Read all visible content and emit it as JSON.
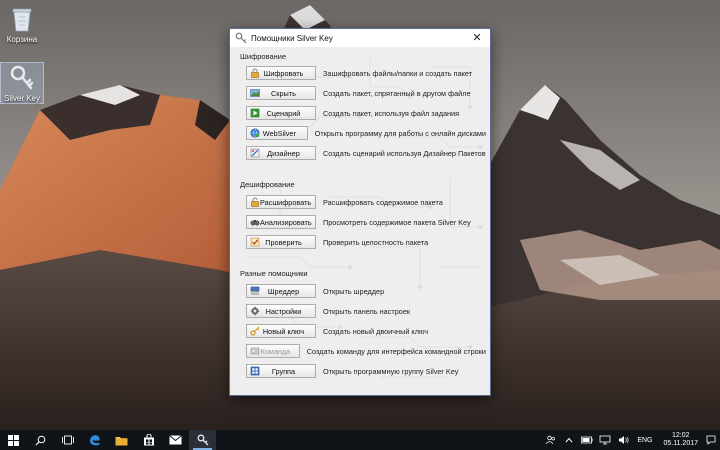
{
  "desktop": {
    "icons": [
      {
        "label": "Корзина",
        "icon": "recycle-bin-icon"
      },
      {
        "label": "Silver Key",
        "icon": "silver-key-icon"
      }
    ]
  },
  "dialog": {
    "title": "Помощники Silver Key",
    "close_glyph": "✕",
    "sections": [
      {
        "title": "Шифрование",
        "rows": [
          {
            "button": "Шифровать",
            "icon": "lock-icon",
            "description": "Зашифровать файлы/папки и создать пакет",
            "enabled": true
          },
          {
            "button": "Скрыть",
            "icon": "image-icon",
            "description": "Создать пакет, спрятанный в другом файле",
            "enabled": true
          },
          {
            "button": "Сценарий",
            "icon": "script-icon",
            "description": "Создать пакет, используя файл задания",
            "enabled": true
          },
          {
            "button": "WebSilver",
            "icon": "globe-icon",
            "description": "Открыть программу для работы с онлайн дисками",
            "enabled": true
          },
          {
            "button": "Дизайнер",
            "icon": "designer-icon",
            "description": "Создать сценарий используя Дизайнер Пакетов",
            "enabled": true
          }
        ]
      },
      {
        "title": "Дешифрование",
        "rows": [
          {
            "button": "Расшифровать",
            "icon": "unlock-icon",
            "description": "Расшифровать содержимое пакета",
            "enabled": true
          },
          {
            "button": "Анализировать",
            "icon": "binoculars-icon",
            "description": "Просмотреть содержимое пакета Silver Key",
            "enabled": true
          },
          {
            "button": "Проверить",
            "icon": "checkmark-icon",
            "description": "Проверить целостность пакета",
            "enabled": true
          }
        ]
      },
      {
        "title": "Разные помощники",
        "rows": [
          {
            "button": "Шреддер",
            "icon": "shredder-icon",
            "description": "Открыть шреддер",
            "enabled": true
          },
          {
            "button": "Настройки",
            "icon": "settings-icon",
            "description": "Открыть панель настроек",
            "enabled": true
          },
          {
            "button": "Новый ключ",
            "icon": "key-icon",
            "description": "Создать новый двоичный ключ",
            "enabled": true
          },
          {
            "button": "Команда",
            "icon": "command-icon",
            "description": "Создать команду для интерфейса командной строки",
            "enabled": false
          },
          {
            "button": "Группа",
            "icon": "group-icon",
            "description": "Открыть программную группу Silver Key",
            "enabled": true
          }
        ]
      }
    ]
  },
  "taskbar": {
    "buttons": [
      {
        "name": "start-button",
        "icon": "windows-logo-icon"
      },
      {
        "name": "search-button",
        "icon": "search-icon"
      },
      {
        "name": "task-view-button",
        "icon": "task-view-icon"
      },
      {
        "name": "edge-button",
        "icon": "edge-icon"
      },
      {
        "name": "file-explorer-button",
        "icon": "folder-icon"
      },
      {
        "name": "store-button",
        "icon": "store-icon"
      },
      {
        "name": "mail-button",
        "icon": "mail-icon"
      },
      {
        "name": "silver-key-taskbar-button",
        "icon": "silver-key-icon",
        "active": true
      }
    ],
    "tray": {
      "language": "ENG",
      "time": "12:02",
      "date": "05.11.2017"
    }
  },
  "colors": {
    "accent": "#7fb3e5",
    "taskbar_bg": "#101418",
    "dialog_bg": "#eeeeee"
  }
}
